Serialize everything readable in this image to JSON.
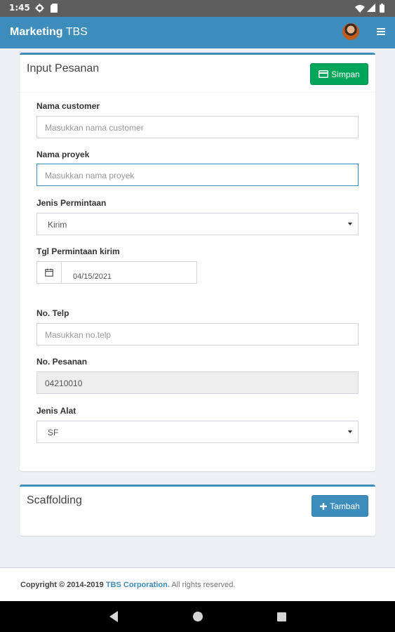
{
  "status_bar": {
    "time": "1:45",
    "icons": [
      "gear-icon",
      "sd-card-icon",
      "wifi-icon",
      "signal-icon",
      "battery-icon"
    ]
  },
  "app_bar": {
    "brand_bold": "Marketing",
    "brand_light": "TBS",
    "menu_icon": "hamburger-menu-icon"
  },
  "order_form": {
    "title": "Input Pesanan",
    "save_label": "Simpan",
    "save_icon": "credit-card-icon",
    "fields": {
      "customer": {
        "label": "Nama customer",
        "placeholder": "Masukkan nama customer"
      },
      "project": {
        "label": "Nama proyek",
        "placeholder": "Masukkan nama proyek"
      },
      "request_type": {
        "label": "Jenis Permintaan",
        "value": "Kirim"
      },
      "request_date": {
        "label": "Tgl Permintaan kirim",
        "value": "04/15/2021",
        "icon": "calendar-icon"
      },
      "phone": {
        "label": "No. Telp",
        "placeholder": "Masukkan no.telp"
      },
      "order_no": {
        "label": "No. Pesanan",
        "value": "04210010"
      },
      "tool_type": {
        "label": "Jenis Alat",
        "value": "SF"
      }
    }
  },
  "scaffolding": {
    "title": "Scaffolding",
    "add_label": "Tambah",
    "add_icon": "plus-icon"
  },
  "footer": {
    "copyright": "Copyright © 2014-2019",
    "company": "TBS Corporation.",
    "rights": "All rights reserved."
  },
  "colors": {
    "primary": "#3c8dbc",
    "success": "#00a65a",
    "background": "#ecf0f5"
  }
}
